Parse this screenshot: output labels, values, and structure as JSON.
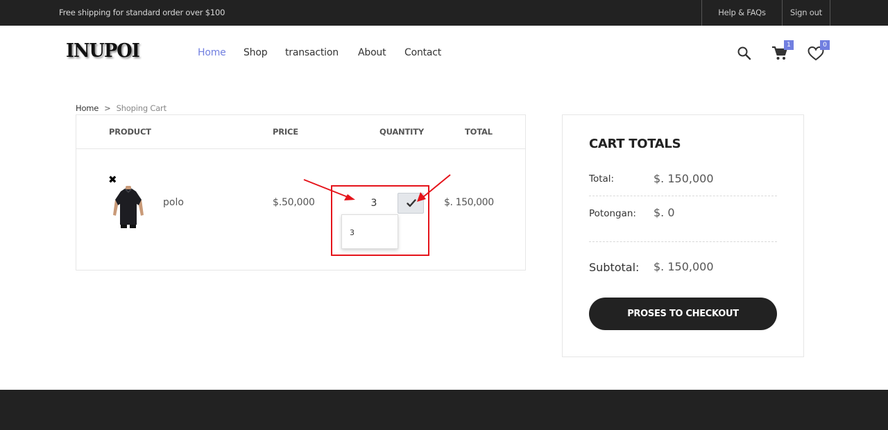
{
  "topbar": {
    "shipping_text": "Free shipping for standard order over $100",
    "help_label": "Help & FAQs",
    "signout_label": "Sign out"
  },
  "header": {
    "logo_text": "INUPOI",
    "nav": {
      "home": "Home",
      "shop": "Shop",
      "transaction": "transaction",
      "about": "About",
      "contact": "Contact"
    },
    "active_nav": "Home",
    "cart_count": "1",
    "wishlist_count": "0",
    "icons": [
      "search-icon",
      "cart-icon",
      "heart-icon"
    ]
  },
  "breadcrumb": {
    "home": "Home",
    "separator": ">",
    "current": "Shoping Cart"
  },
  "cart": {
    "headers": {
      "product": "PRODUCT",
      "price": "PRICE",
      "quantity": "QUANTITY",
      "total": "TOTAL"
    },
    "items": [
      {
        "remove_symbol": "✖",
        "name": "polo",
        "price": "$.50,000",
        "quantity": "3",
        "total": "$. 150,000",
        "autocomplete_value": "3"
      }
    ]
  },
  "totals": {
    "title": "CART TOTALS",
    "total_label": "Total:",
    "total_value": "$. 150,000",
    "potongan_label": "Potongan:",
    "potongan_value": "$. 0",
    "subtotal_label": "Subtotal:",
    "subtotal_value": "$. 150,000",
    "checkout_label": "PROSES TO CHECKOUT"
  },
  "colors": {
    "accent": "#717fe0",
    "dark": "#222222",
    "annotation": "#e5141b"
  }
}
